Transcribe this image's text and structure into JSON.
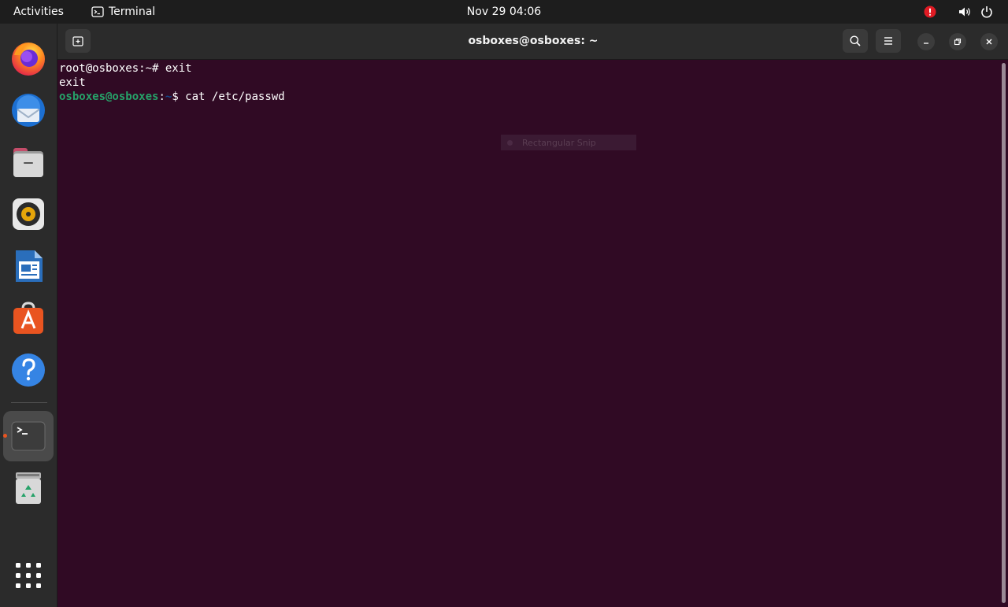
{
  "topbar": {
    "activities_label": "Activities",
    "app_name": "Terminal",
    "clock": "Nov 29  04:06"
  },
  "dock": {
    "items": [
      {
        "name": "firefox",
        "icon": "firefox-icon"
      },
      {
        "name": "thunderbird",
        "icon": "thunderbird-icon"
      },
      {
        "name": "files",
        "icon": "files-icon"
      },
      {
        "name": "rhythmbox",
        "icon": "rhythmbox-icon"
      },
      {
        "name": "libreoffice-writer",
        "icon": "writer-icon"
      },
      {
        "name": "ubuntu-software",
        "icon": "software-icon"
      },
      {
        "name": "help",
        "icon": "help-icon"
      },
      {
        "name": "terminal",
        "icon": "terminal-icon",
        "active": true
      },
      {
        "name": "trash",
        "icon": "trash-icon"
      },
      {
        "name": "show-applications",
        "icon": "app-grid-icon"
      }
    ]
  },
  "window": {
    "title": "osboxes@osboxes: ~"
  },
  "terminal": {
    "line1": "root@osboxes:~# exit",
    "line2": "exit",
    "line3": {
      "user_host": "osboxes@osboxes",
      "sep": ":",
      "path": "~",
      "prompt": "$ ",
      "command": "cat /etc/passwd"
    }
  },
  "overlay": {
    "snip_label": "Rectangular Snip"
  },
  "colors": {
    "terminal_bg": "#300a24",
    "prompt_user": "#26a269",
    "prompt_path": "#12488b",
    "accent": "#e95420"
  }
}
